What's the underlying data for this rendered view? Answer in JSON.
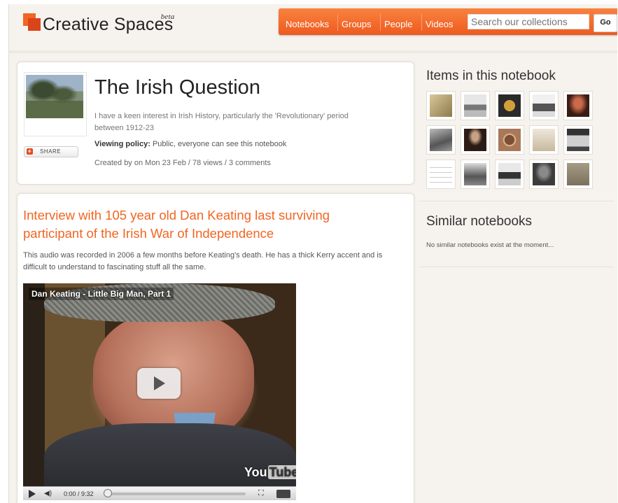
{
  "brand": {
    "name": "Creative Spaces",
    "badge": "beta"
  },
  "nav": {
    "items": [
      "Notebooks",
      "Groups",
      "People",
      "Videos"
    ]
  },
  "search": {
    "placeholder": "Search our collections",
    "go_label": "Go"
  },
  "notebook": {
    "title": "The Irish Question",
    "description": "I have a keen interest in Irish History, particularly the 'Revolutionary' period between 1912-23",
    "policy_label": "Viewing policy:",
    "policy_value": "Public, everyone can see this notebook",
    "created": "Created by on Mon 23 Feb / 78 views / 3 comments",
    "share_label": "SHARE"
  },
  "item": {
    "title": "Interview with 105 year old Dan Keating last surviving participant of the Irish War of Independence",
    "description": "This audio was recorded in 2006 a few months before Keating's death. He has a thick Kerry accent and is difficult to understand to fascinating stuff all the same.",
    "video": {
      "title": "Dan Keating - Little Big Man, Part 1",
      "time": "0:00 / 9:32",
      "logo_a": "You",
      "logo_b": "Tube"
    }
  },
  "sidebar": {
    "items_heading": "Items in this notebook",
    "similar_heading": "Similar notebooks",
    "similar_empty": "No similar notebooks exist at the moment..."
  },
  "colors": {
    "accent": "#f26522",
    "nav_bg": "#ee5a1f"
  },
  "icons": {
    "play": "play-icon",
    "share": "share-icon"
  }
}
